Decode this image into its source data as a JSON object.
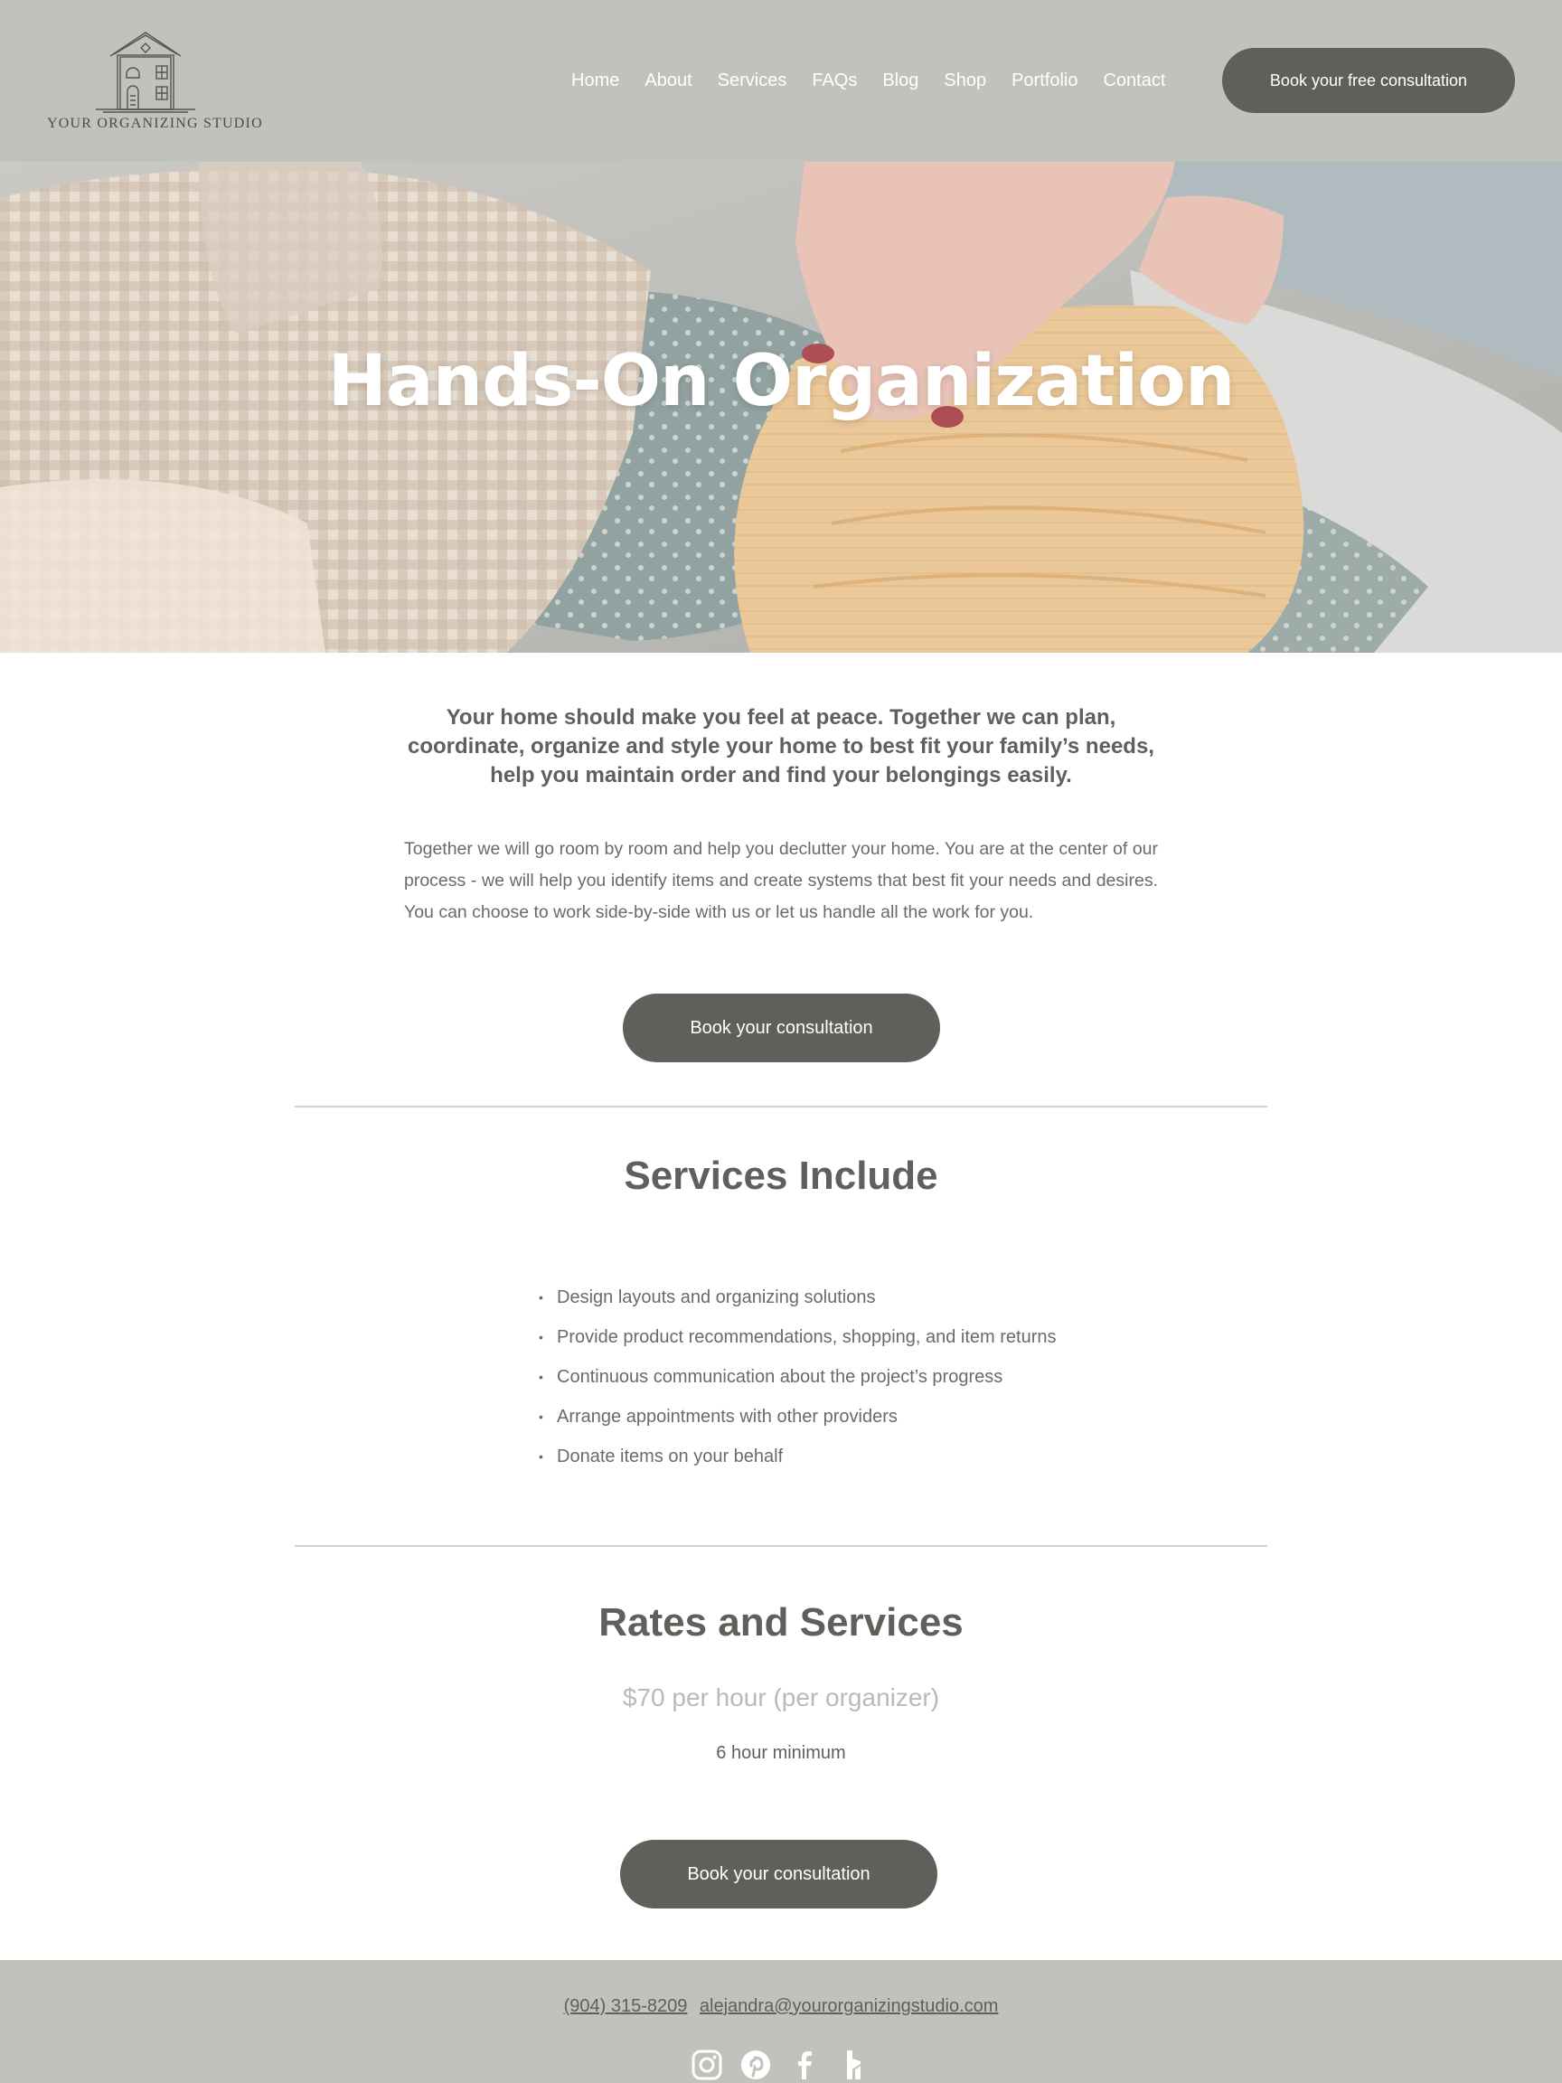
{
  "header": {
    "logo_text": "YOUR ORGANIZING STUDIO",
    "nav": [
      "Home",
      "About",
      "Services",
      "FAQs",
      "Blog",
      "Shop",
      "Portfolio",
      "Contact"
    ],
    "cta_label": "Book your free consultation"
  },
  "hero": {
    "title": "Hands-On Organization"
  },
  "intro": {
    "lead": "Your home should make you feel at peace. Together we can plan, coordinate, organize and style your home to best fit your family’s needs, help you maintain order and find your belongings easily.",
    "body": "Together we will go room by room and help you declutter your home. You are at the center of our process - we will help you identify items and create systems that best fit your needs and desires. You can choose to work side-by-side with us or let us handle all the work for you.",
    "cta_label": "Book your consultation"
  },
  "services": {
    "heading": "Services Include",
    "items": [
      "Design layouts and organizing solutions",
      "Provide product recommendations, shopping, and item returns",
      "Continuous communication about the project’s progress",
      "Arrange appointments with other providers",
      "Donate items on your behalf"
    ]
  },
  "rates": {
    "heading": "Rates and Services",
    "price": "$70 per hour (per organizer)",
    "minimum": "6 hour minimum",
    "cta_label": "Book your consultation"
  },
  "footer": {
    "phone": "(904) 315-8209",
    "email": "alejandra@yourorganizingstudio.com",
    "social": [
      "instagram-icon",
      "pinterest-icon",
      "facebook-icon",
      "houzz-icon"
    ]
  },
  "colors": {
    "header_bg": "#bfc3bc",
    "button_bg": "#5f605b",
    "text": "#5f605b",
    "price_text": "#b9b9b6"
  }
}
